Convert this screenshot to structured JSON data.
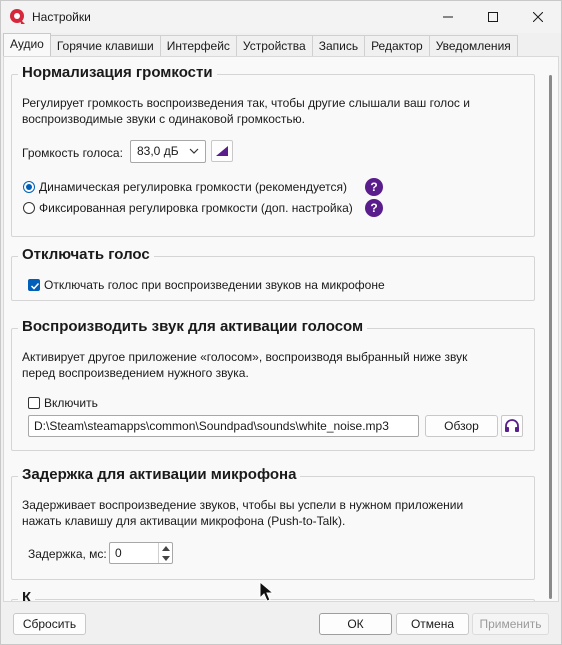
{
  "window": {
    "title": "Настройки"
  },
  "tabs": [
    {
      "label": "Аудио",
      "active": true
    },
    {
      "label": "Горячие клавиши"
    },
    {
      "label": "Интерфейс"
    },
    {
      "label": "Устройства"
    },
    {
      "label": "Запись"
    },
    {
      "label": "Редактор"
    },
    {
      "label": "Уведомления"
    }
  ],
  "normalization": {
    "title": "Нормализация громкости",
    "desc_line1": "Регулирует громкость воспроизведения так, чтобы другие слышали ваш голос и",
    "desc_line2": "воспроизводимые звуки с одинаковой громкостью.",
    "voice_volume_label": "Громкость голоса:",
    "voice_volume_value": "83,0 дБ",
    "radio_dynamic": "Динамическая регулировка громкости (рекомендуется)",
    "radio_fixed": "Фиксированная регулировка громкости (доп. настройка)",
    "selected_mode": "dynamic",
    "help_glyph": "?"
  },
  "mute_voice": {
    "title": "Отключать голос",
    "checkbox_label": "Отключать голос при воспроизведении звуков на микрофоне",
    "checked": true
  },
  "voice_activation": {
    "title": "Воспроизводить звук для активации голосом",
    "desc_line1": "Активирует другое приложение «голосом», воспроизводя выбранный ниже звук",
    "desc_line2": "перед воспроизведением нужного звука.",
    "enable_label": "Включить",
    "enabled": false,
    "file_path": "D:\\Steam\\steamapps\\common\\Soundpad\\sounds\\white_noise.mp3",
    "browse_label": "Обзор"
  },
  "mic_delay": {
    "title": "Задержка для активации микрофона",
    "desc_line1": "Задерживает воспроизведение звуков, чтобы вы успели в нужном приложении",
    "desc_line2": "нажать клавишу для активации микрофона (Push-to-Talk).",
    "delay_label": "Задержка, мс:",
    "delay_value": "0"
  },
  "next_section_partial": "К",
  "footer": {
    "reset_label": "Сбросить",
    "ok_label": "ОК",
    "cancel_label": "Отмена",
    "apply_label": "Применить"
  },
  "colors": {
    "accent": "#005fb8",
    "help": "#5a1d8c",
    "app_icon": "#d6283b"
  }
}
